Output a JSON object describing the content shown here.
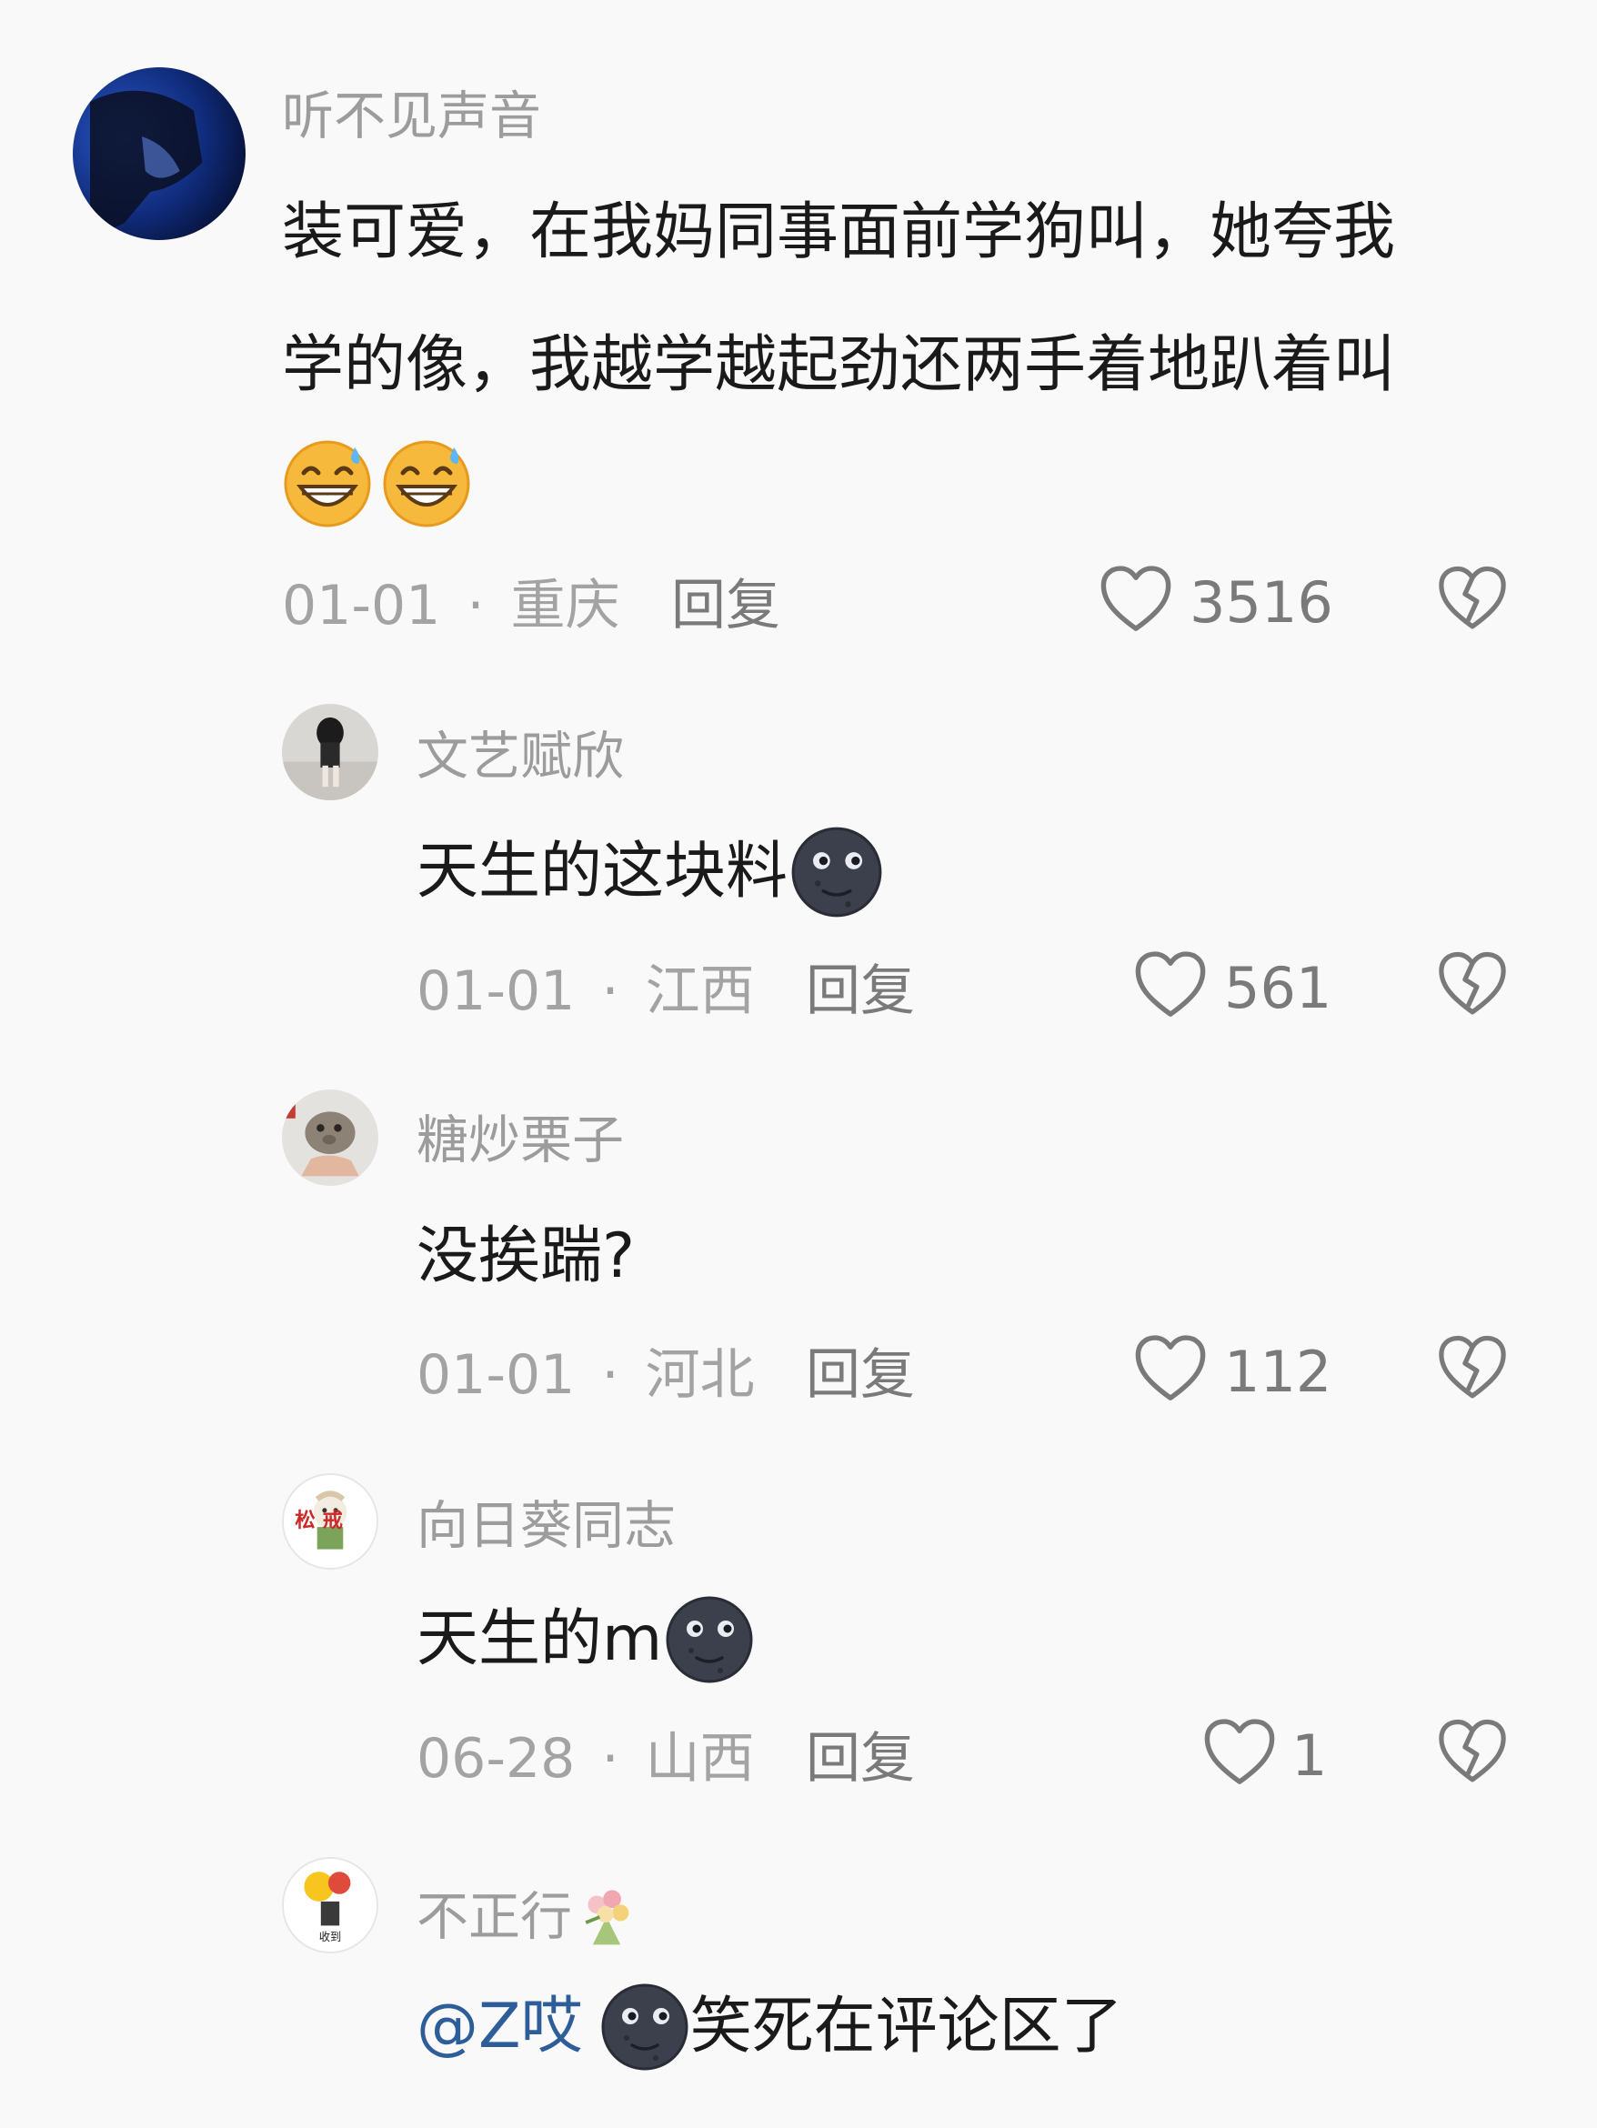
{
  "comments": [
    {
      "username": "听不见声音",
      "text_line1": "装可爱，在我妈同事面前学狗叫，她夸我",
      "text_line2": "学的像，我越学越起劲还两手着地趴着叫",
      "emojis": [
        "grinning-sweat-emoji",
        "grinning-sweat-emoji"
      ],
      "date": "01-01",
      "separator": "·",
      "location": "重庆",
      "reply_label": "回复",
      "likes": "3516"
    },
    {
      "username": "文艺赋欣",
      "text": "天生的这块料",
      "emoji": "new-moon-face-emoji",
      "date": "01-01",
      "separator": "·",
      "location": "江西",
      "reply_label": "回复",
      "likes": "561"
    },
    {
      "username": "糖炒栗子",
      "text": "没挨踹?",
      "date": "01-01",
      "separator": "·",
      "location": "河北",
      "reply_label": "回复",
      "likes": "112"
    },
    {
      "username": "向日葵同志",
      "text": "天生的m",
      "emoji": "new-moon-face-emoji",
      "date": "06-28",
      "separator": "·",
      "location": "山西",
      "reply_label": "回复",
      "likes": "1",
      "avatar_text": "松 戒"
    },
    {
      "username": "不正行",
      "username_emoji": "bouquet-emoji",
      "mention": "@Z哎",
      "text": "笑死在评论区了",
      "emoji": "new-moon-face-emoji",
      "avatar_text": "收到"
    }
  ],
  "colors": {
    "background": "#f9f9f9",
    "username": "#9c9c9c",
    "text": "#1a1a1a",
    "meta": "#a3a3a3",
    "mention": "#2e5e9a"
  }
}
